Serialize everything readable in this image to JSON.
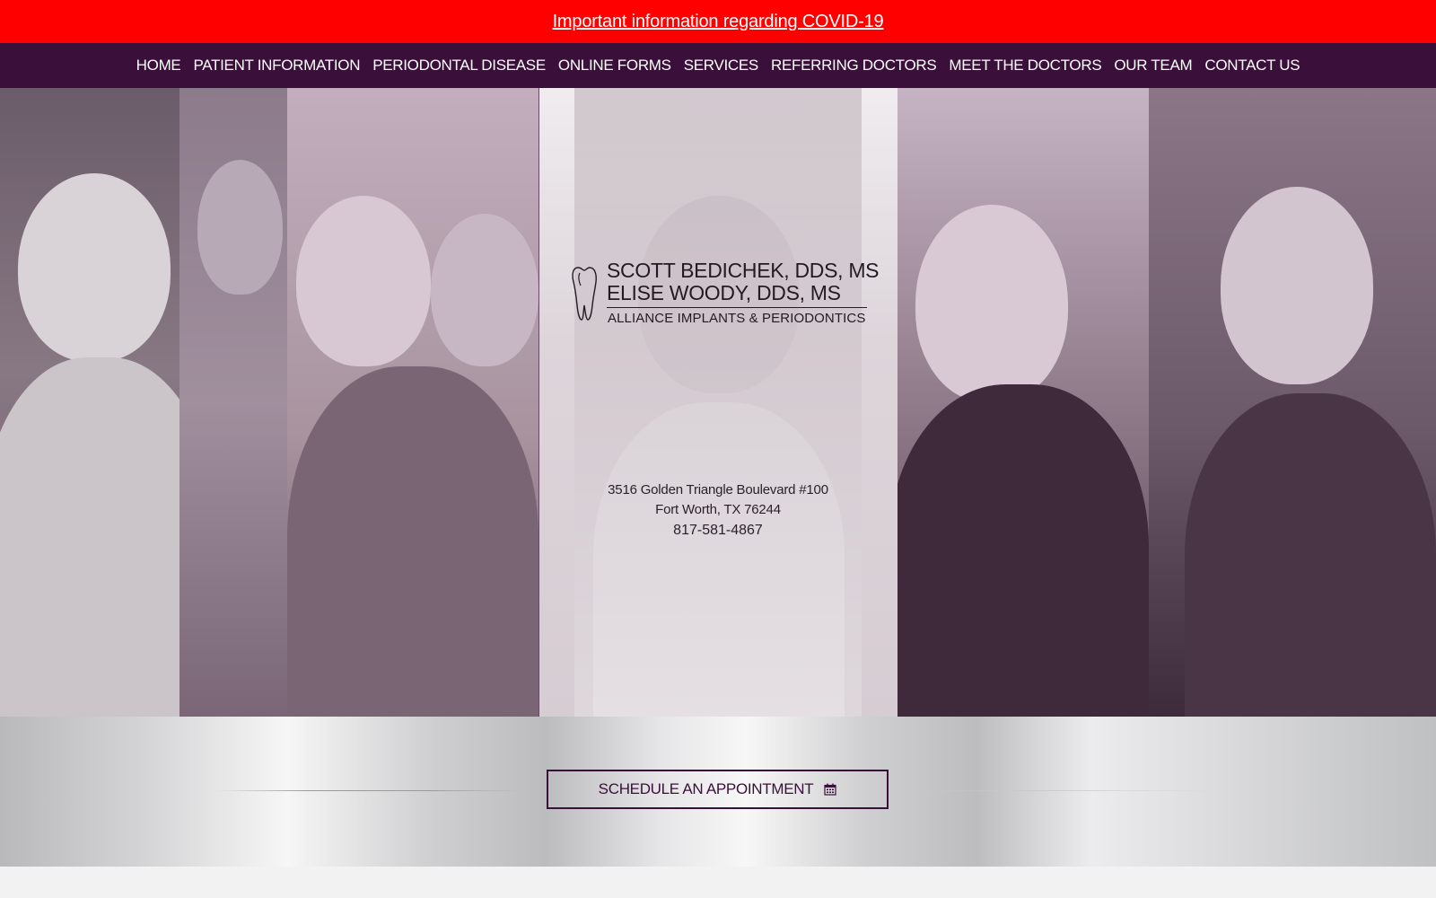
{
  "announcement": {
    "text": "Important information regarding COVID-19"
  },
  "nav": {
    "items": [
      {
        "label": "HOME"
      },
      {
        "label": "PATIENT INFORMATION"
      },
      {
        "label": "PERIODONTAL DISEASE"
      },
      {
        "label": "ONLINE FORMS"
      },
      {
        "label": "SERVICES"
      },
      {
        "label": "REFERRING DOCTORS"
      },
      {
        "label": "MEET THE DOCTORS"
      },
      {
        "label": "OUR TEAM"
      },
      {
        "label": "CONTACT US"
      }
    ]
  },
  "logo": {
    "doctor1": "SCOTT BEDICHEK, DDS, MS",
    "doctor2": "ELISE WOODY, DDS, MS",
    "practice": "ALLIANCE IMPLANTS & PERIODONTICS",
    "icon": "tooth-icon"
  },
  "contact": {
    "address_line1": "3516 Golden Triangle Boulevard #100",
    "address_line2": "Fort Worth, TX 76244",
    "phone": "817-581-4867"
  },
  "cta": {
    "label": "SCHEDULE AN APPOINTMENT",
    "icon": "calendar-icon"
  },
  "colors": {
    "announcement_bg": "#ff0000",
    "nav_bg": "#3a0f3a",
    "accent": "#3a0f3a"
  }
}
